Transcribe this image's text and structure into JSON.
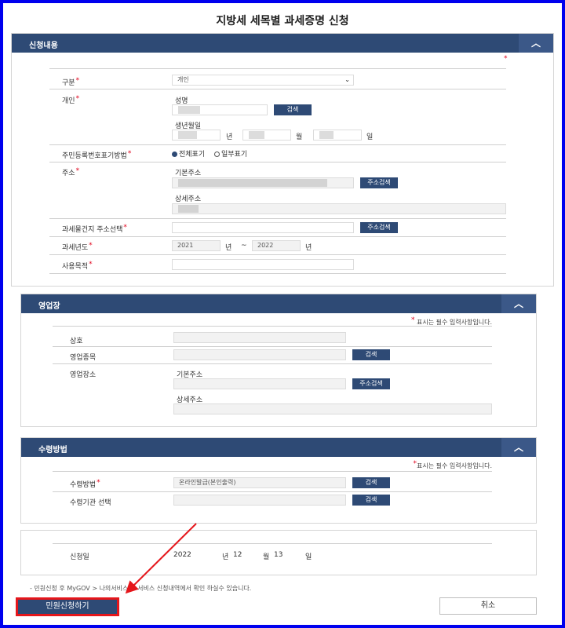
{
  "page_title": "지방세 세목별 과세증명 신청",
  "required_mark": "*",
  "s1": {
    "title": "신청내용",
    "collapse": "︿",
    "type_label": "구분",
    "type_value": "개인",
    "personal_label": "개인",
    "name_sub": "성명",
    "search_btn": "검색",
    "birth_sub": "생년월일",
    "year_unit": "년",
    "month_unit": "월",
    "day_unit": "일",
    "rrn_label": "주민등록번호표기방법",
    "rrn_full": "전체표기",
    "rrn_partial": "일부표기",
    "addr_label": "주소",
    "addr_basic_sub": "기본주소",
    "addr_search_btn": "주소검색",
    "addr_detail_sub": "상세주소",
    "prop_label": "과세물건지 주소선택",
    "prop_search_btn": "주소검색",
    "tax_year_label": "과세년도",
    "year_from": "2021",
    "year_sep": "~",
    "year_to": "2022",
    "purpose_label": "사용목적"
  },
  "s2": {
    "title": "영업장",
    "collapse": "︿",
    "required_note": "표시는 필수 입력사항입니다.",
    "trade_name_label": "상호",
    "business_type_label": "영업종목",
    "search_btn": "검색",
    "location_label": "영업장소",
    "basic_sub": "기본주소",
    "addr_search_btn": "주소검색",
    "detail_sub": "상세주소"
  },
  "s3": {
    "title": "수령방법",
    "collapse": "︿",
    "required_note": "표시는 필수 입력사항입니다.",
    "method_label": "수령방법",
    "method_value": "온라인발급(본인출력)",
    "search_btn": "검색",
    "agency_label": "수령기관 선택",
    "agency_search_btn": "검색"
  },
  "s4": {
    "date_label": "신청일",
    "year": "2022",
    "year_unit": "년",
    "month": "12",
    "month_unit": "월",
    "day": "13",
    "day_unit": "일"
  },
  "footnote": "- 민원신청 후 MyGOV > 나의서비스 > 서비스 신청내역에서 확인 하실수 있습니다.",
  "submit_btn": "민원신청하기",
  "cancel_btn": "취소",
  "colors": {
    "header": "#2e4a75",
    "highlight": "#e5161b",
    "frame": "#0000ee"
  }
}
